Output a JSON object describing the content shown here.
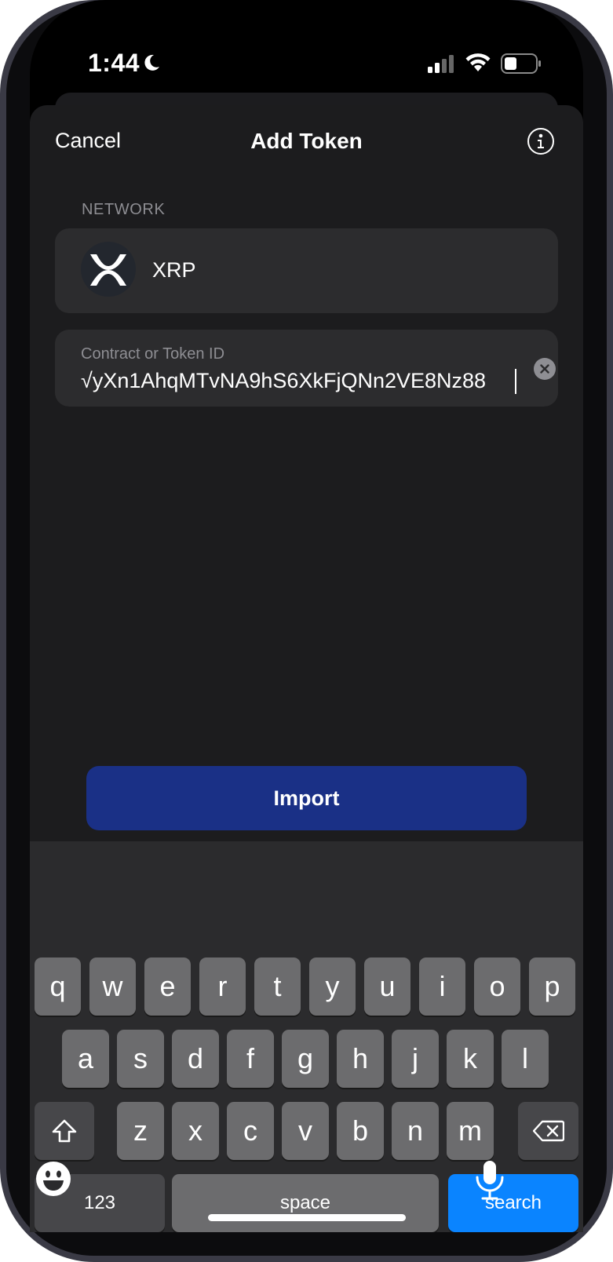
{
  "status_bar": {
    "time": "1:44",
    "icons": [
      "moon-icon",
      "cellular-signal-icon",
      "wifi-icon",
      "battery-icon"
    ]
  },
  "nav": {
    "cancel_label": "Cancel",
    "title": "Add Token",
    "info_icon": "info-icon"
  },
  "network": {
    "section_label": "NETWORK",
    "selected_name": "XRP",
    "logo_icon": "xrp-logo-icon"
  },
  "token_field": {
    "label": "Contract or Token ID",
    "value": "√yXn1AhqMTvNA9hS6XkFjQNn2VE8Nz88",
    "clear_icon": "clear-icon"
  },
  "import_button": {
    "label": "Import"
  },
  "keyboard": {
    "row1": [
      "q",
      "w",
      "e",
      "r",
      "t",
      "y",
      "u",
      "i",
      "o",
      "p"
    ],
    "row2": [
      "a",
      "s",
      "d",
      "f",
      "g",
      "h",
      "j",
      "k",
      "l"
    ],
    "row3": [
      "z",
      "x",
      "c",
      "v",
      "b",
      "n",
      "m"
    ],
    "shift_icon": "shift-icon",
    "delete_icon": "delete-icon",
    "numbers_label": "123",
    "space_label": "space",
    "search_label": "search",
    "emoji_icon": "emoji-icon",
    "mic_icon": "microphone-icon"
  },
  "colors": {
    "background": "#1c1c1e",
    "field": "#2c2c2e",
    "import_button": "#1a3086",
    "search_key": "#0a84ff"
  }
}
